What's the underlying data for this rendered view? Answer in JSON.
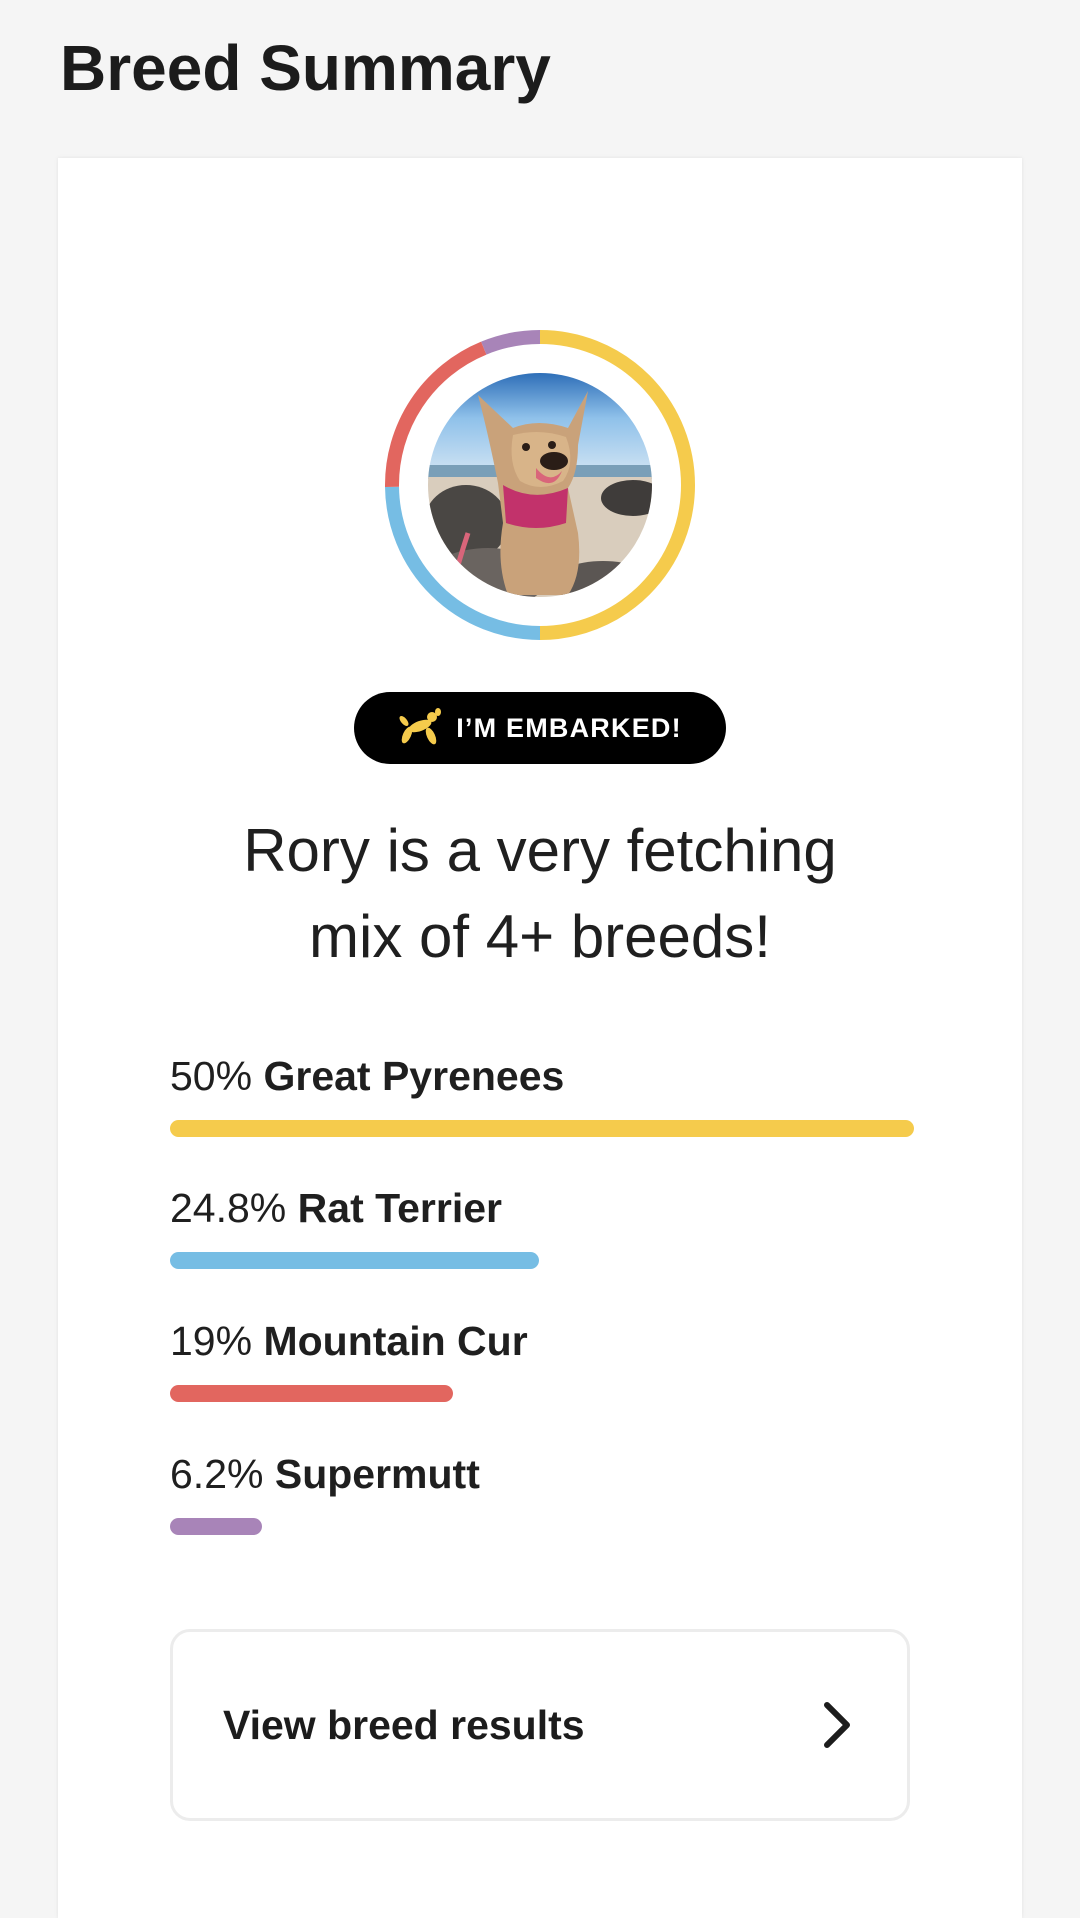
{
  "page": {
    "title": "Breed Summary"
  },
  "card": {
    "photo_alt": "dog photo",
    "badge_label": "I’M EMBARKED!",
    "badge_icon": "balloon-dog-icon",
    "headline_line1": "Rory is a very fetching",
    "headline_line2": "mix of 4+ breeds!",
    "breeds": [
      {
        "pct": "50%",
        "name": "Great Pyrenees",
        "value": 50,
        "color": "#f5cb4c"
      },
      {
        "pct": "24.8%",
        "name": "Rat Terrier",
        "value": 24.8,
        "color": "#76bde4"
      },
      {
        "pct": "19%",
        "name": "Mountain Cur",
        "value": 19,
        "color": "#e2665f"
      },
      {
        "pct": "6.2%",
        "name": "Supermutt",
        "value": 6.2,
        "color": "#a884b8"
      }
    ],
    "view_button_label": "View breed results",
    "view_button_icon": "chevron-right-icon"
  }
}
